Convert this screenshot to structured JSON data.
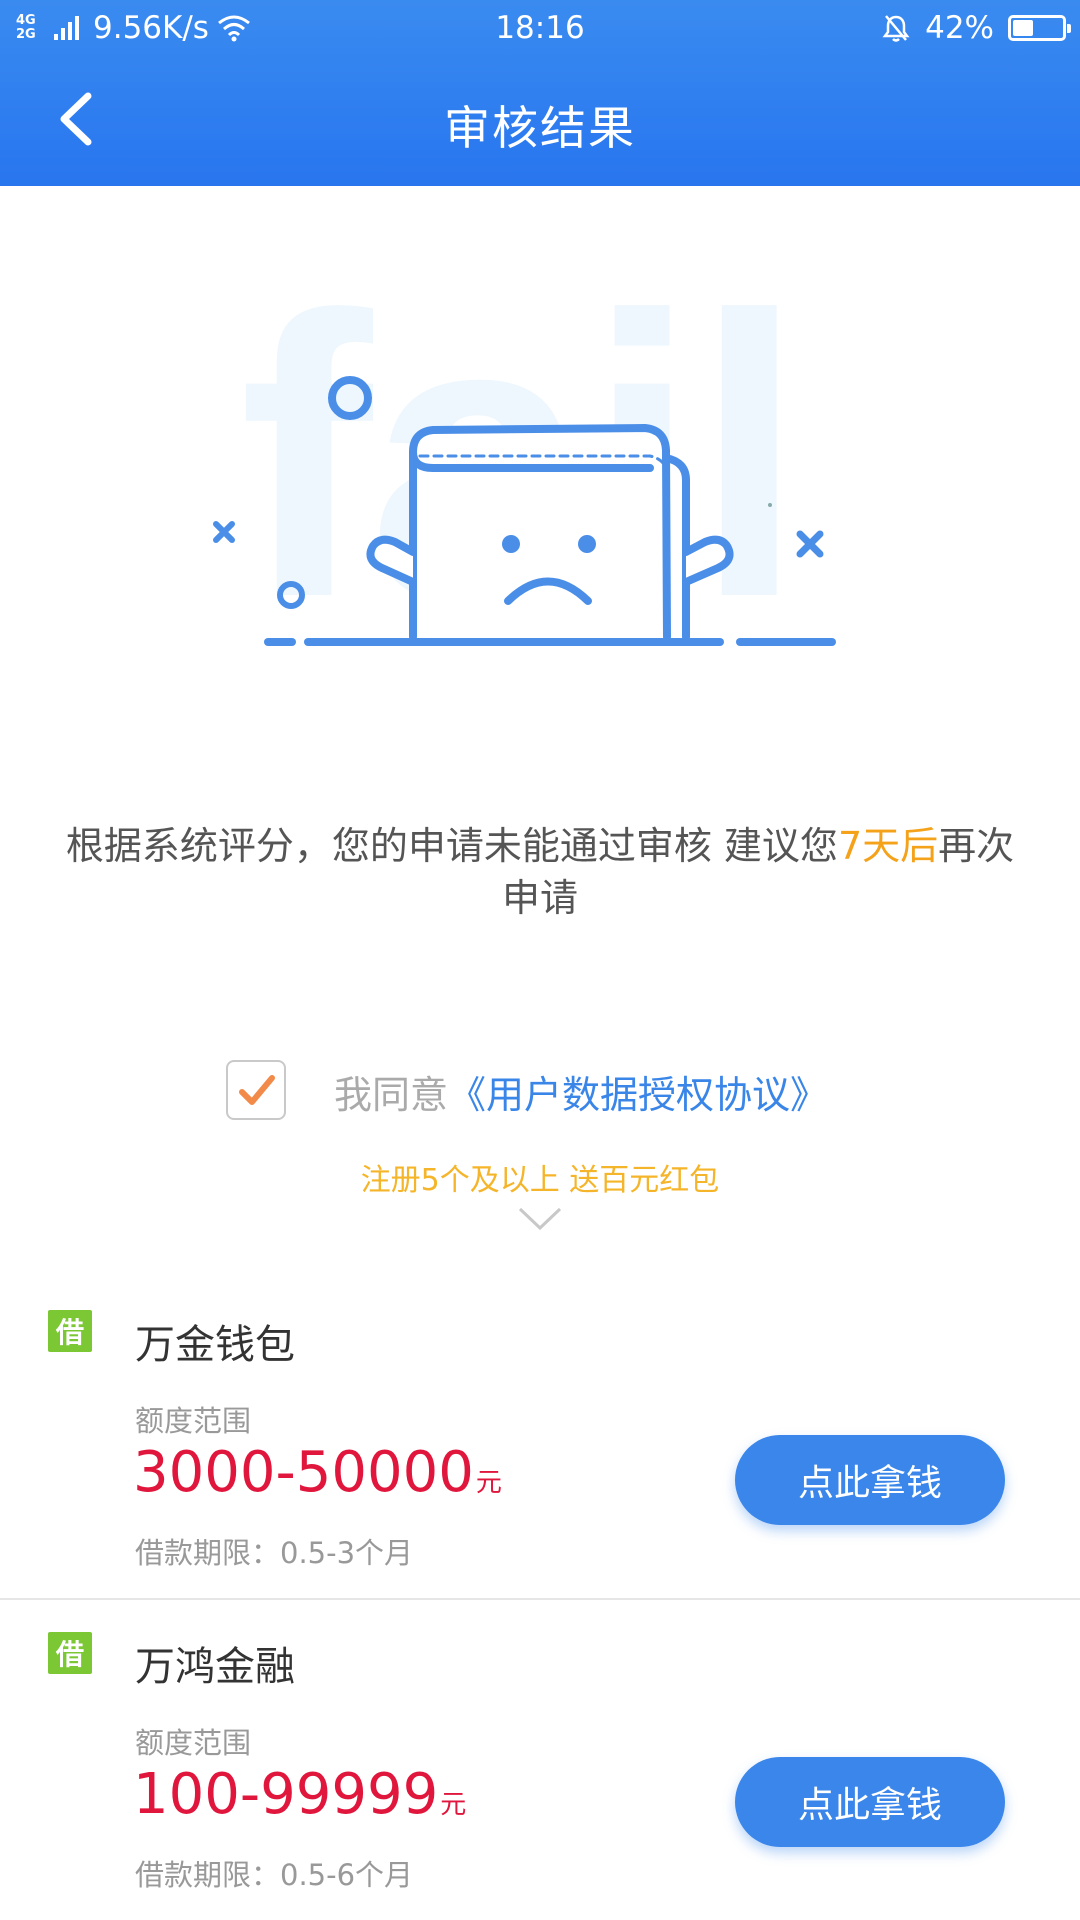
{
  "status_bar": {
    "network": [
      "4G",
      "2G"
    ],
    "speed": "9.56K/s",
    "time": "18:16",
    "battery_percent": "42%",
    "battery_level": 0.42,
    "icons": [
      "signal-bars-icon",
      "wifi-icon",
      "bell-off-icon",
      "battery-icon"
    ]
  },
  "nav": {
    "title": "审核结果",
    "back_icon": "chevron-left-icon"
  },
  "illustration": {
    "watermark_text": "fail",
    "icon": "sad-box-icon"
  },
  "message": {
    "part1": "根据系统评分，您的申请未能通过审核 建议您",
    "highlight": "7天后",
    "part2": "再次申请"
  },
  "agreement": {
    "checked": true,
    "prefix": "我同意",
    "link": "《用户数据授权协议》"
  },
  "promo": {
    "text": "注册5个及以上 送百元红包"
  },
  "loans": [
    {
      "badge": "借",
      "name": "万金钱包",
      "limit_label": "额度范围",
      "limit_value": "3000-50000",
      "unit": "元",
      "term": "借款期限：0.5-3个月",
      "button": "点此拿钱"
    },
    {
      "badge": "借",
      "name": "万鸿金融",
      "limit_label": "额度范围",
      "limit_value": "100-99999",
      "unit": "元",
      "term": "借款期限：0.5-6个月",
      "button": "点此拿钱"
    }
  ],
  "colors": {
    "header": "#2f7ef0",
    "accent": "#3a86ea",
    "highlight": "#f5a21b",
    "amount": "#e0163c",
    "badge": "#7cc734"
  }
}
